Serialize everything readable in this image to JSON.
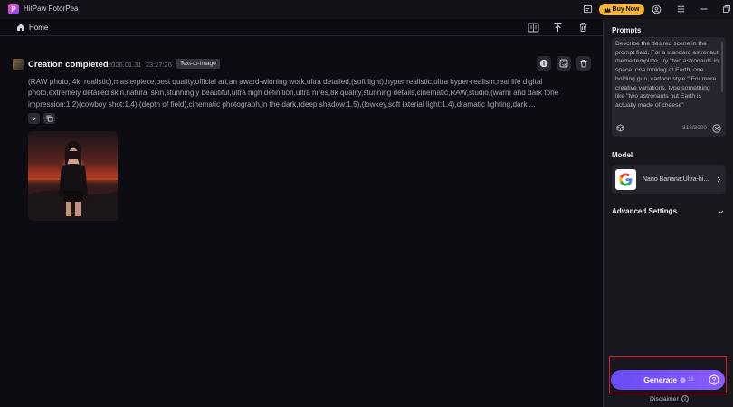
{
  "app": {
    "title": "HitPaw FotorPea",
    "logo_letter": "P"
  },
  "titlebar": {
    "buy_label": "Buy Now"
  },
  "nav": {
    "home_label": "Home"
  },
  "creation": {
    "title": "Creation completed",
    "timestamp": "2026.01.31  23:27:26",
    "badge": "Text-to-Image",
    "prompt": "(RAW photo, 4k, realistic),masterpiece,best quality,official art,an award-winning work,ultra detailed,(soft light),hyper realistic,ultra hyper-realism,real life digital photo,extremely detailed skin,natural skin,stunningly beautiful,ultra high definition,ultra hires,8k quality,stunning details,cinematic,RAW,studio,(warm and dark tone impression:1.2)(cowboy shot:1.4),(depth of field),cinematic photograph,in the dark,(deep shadow:1.5),(lowkey,soft laterial light:1.4),dramatic lighting,dark ..."
  },
  "panel": {
    "prompts_heading": "Prompts",
    "prompt_placeholder": "Describe the desired scene in the prompt field. For a standard astronaut meme template, try \"two astronauts in space, one looking at Earth, one holding gun, cartoon style.\" For more creative variations, type something like \"two astronauts but Earth is actually made of cheese\"",
    "char_count": "318/3000",
    "model_heading": "Model",
    "model_name": "Nano Banana:Ultra-hi...",
    "advanced_label": "Advanced Settings",
    "generate_label": "Generate",
    "generate_cost": "18",
    "disclaimer_label": "Disclaimer"
  },
  "colors": {
    "accent": "#7b52ff",
    "buy": "#f2b33a",
    "highlight": "#e0142b"
  }
}
